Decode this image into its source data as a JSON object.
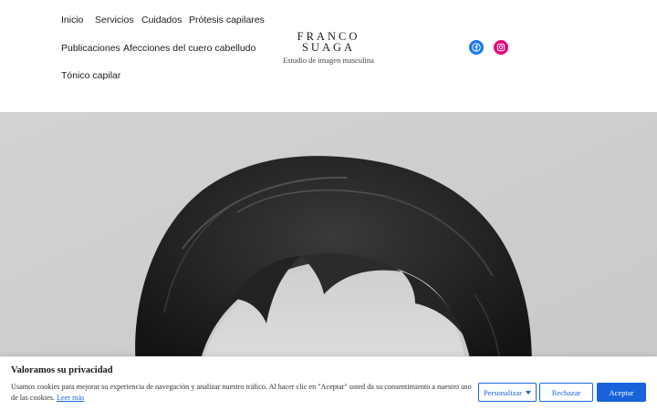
{
  "header": {
    "nav": [
      {
        "label": "Inicio"
      },
      {
        "label": "Servicios"
      },
      {
        "label": "Cuidados"
      },
      {
        "label": "Prótesis capilares"
      },
      {
        "label": "Publicaciones"
      },
      {
        "label": "Afecciones del cuero cabelludo"
      },
      {
        "label": "Tónico capilar"
      }
    ],
    "logo": {
      "line1": "FRANCO",
      "line2": "SUAGA",
      "tagline": "Estudio de imagen masculina"
    },
    "social": [
      {
        "name": "facebook-icon",
        "color": "#1877f2"
      },
      {
        "name": "instagram-icon",
        "color": "#e4007c"
      }
    ]
  },
  "cookie_banner": {
    "title": "Valoramos su privacidad",
    "text": "Usamos cookies para mejorar su experiencia de navegación y analizar nuestro tráfico. Al hacer clic en \"Aceptar\" usted da su consentimiento a nuestro uso de las cookies.",
    "link": "Leer más",
    "customize_label": "Personalizar",
    "reject_label": "Rechazar",
    "accept_label": "Aceptar",
    "accent_color": "#1863dc"
  }
}
